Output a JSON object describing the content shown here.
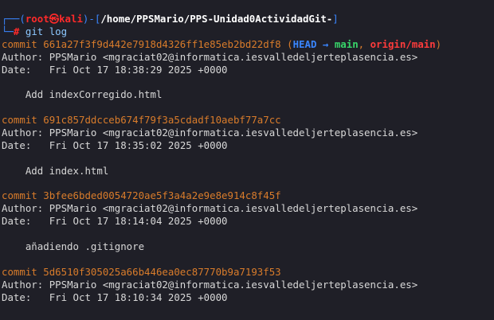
{
  "prompt": {
    "corner_top": "┌──(",
    "user": "root",
    "skull": "㉿",
    "host": "kali",
    "sep": ")-[",
    "path": "/home/PPSMario/PPS-Unidad0ActividadGit-",
    "end": "]",
    "corner_bottom": "└─",
    "hash": "#",
    "command": "git log"
  },
  "commits": [
    {
      "label": "commit",
      "hash": "661a27f3f9d442e7918d4326ff1e85eb2bd22df8",
      "refs": {
        "open": "(",
        "head": "HEAD",
        "arrow": " → ",
        "main": "main",
        "comma": ", ",
        "origin": "origin/main",
        "close": ")"
      },
      "author_label": "Author:",
      "author": "PPSMario <mgraciat02@informatica.iesvalledeljerteplasencia.es>",
      "date_label": "Date:",
      "date": "Fri Oct 17 18:38:29 2025 +0000",
      "message": "Add indexCorregido.html"
    },
    {
      "label": "commit",
      "hash": "691c857ddcceb674f79f3a5cdadf10aebf77a7cc",
      "author_label": "Author:",
      "author": "PPSMario <mgraciat02@informatica.iesvalledeljerteplasencia.es>",
      "date_label": "Date:",
      "date": "Fri Oct 17 18:35:02 2025 +0000",
      "message": "Add index.html"
    },
    {
      "label": "commit",
      "hash": "3bfee6bded0054720ae5f3a4a2e9e8e914c8f45f",
      "author_label": "Author:",
      "author": "PPSMario <mgraciat02@informatica.iesvalledeljerteplasencia.es>",
      "date_label": "Date:",
      "date": "Fri Oct 17 18:14:04 2025 +0000",
      "message": "añadiendo .gitignore"
    },
    {
      "label": "commit",
      "hash": "5d6510f305025a66b446ea0ec87770b9a7193f53",
      "author_label": "Author:",
      "author": "PPSMario <mgraciat02@informatica.iesvalledeljerteplasencia.es>",
      "date_label": "Date:",
      "date": "Fri Oct 17 18:10:34 2025 +0000"
    }
  ],
  "colors": {
    "background": "#1f1f27",
    "prompt_frame": "#3a86ff",
    "user_host": "#ff2a2a",
    "commit_hash": "#d97c2b",
    "head_ref": "#3a86ff",
    "branch_ref": "#38d66a",
    "remote_ref": "#ff3b3b",
    "text": "#d8d8d8"
  }
}
